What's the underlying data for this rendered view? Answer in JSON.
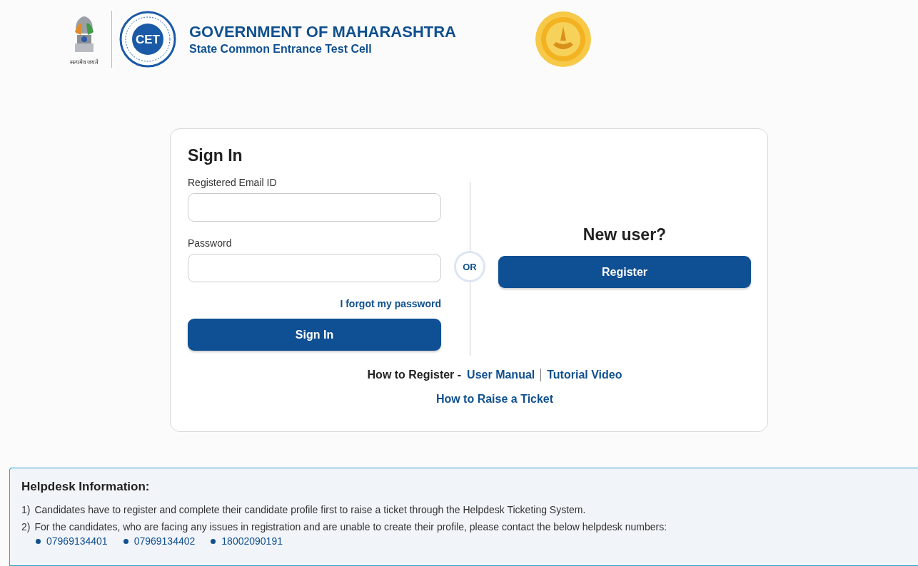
{
  "header": {
    "emblem_motto": "सत्यमेव जयते",
    "logo_text": "CET",
    "title": "GOVERNMENT OF MAHARASHTRA",
    "subtitle": "State Common Entrance Test Cell"
  },
  "sign_in": {
    "title": "Sign In",
    "email_label": "Registered Email ID",
    "password_label": "Password",
    "forgot_link": "I forgot my password",
    "button": "Sign In"
  },
  "divider_badge": "OR",
  "new_user": {
    "title": "New user?",
    "button": "Register"
  },
  "help_links": {
    "how_to_register": "How to Register -",
    "links": [
      "User Manual",
      "Tutorial Video"
    ],
    "ticket_link": "How to Raise a Ticket"
  },
  "helpdesk": {
    "title": "Helpdesk Information:",
    "items": [
      {
        "marker": "1)",
        "text": "Candidates have to register and complete their candidate profile first to raise a ticket through the Helpdesk Ticketing System."
      },
      {
        "marker": "2)",
        "text": "For the candidates, who are facing any issues in registration and are unable to create their profile, please contact the below helpdesk numbers:"
      }
    ],
    "numbers": [
      "07969134401",
      "07969134402",
      "18002090191"
    ]
  }
}
